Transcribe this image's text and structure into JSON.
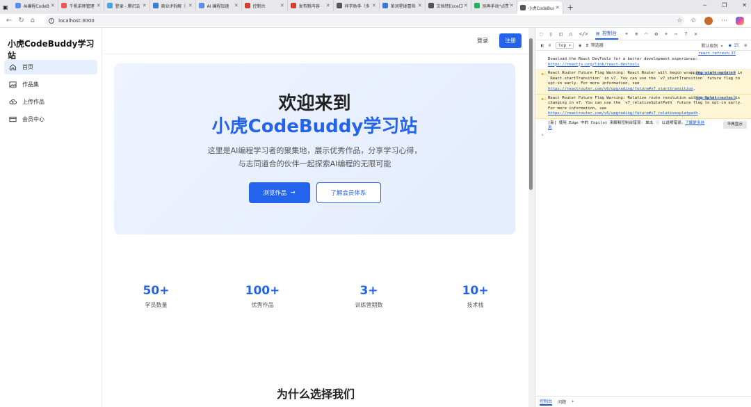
{
  "browser": {
    "tabs": [
      {
        "label": "AI编程CodeBu",
        "color": "#5b8def"
      },
      {
        "label": "千帆讲师管理",
        "color": "#e85a5a"
      },
      {
        "label": "登录 - 腾讯云",
        "color": "#4aa3df"
      },
      {
        "label": "商业IP拆解（",
        "color": "#3a7bd5"
      },
      {
        "label": "AI 编程加速",
        "color": "#5b8def"
      },
      {
        "label": "控制台",
        "color": "#d23f31"
      },
      {
        "label": "发布新内容",
        "color": "#d23f31"
      },
      {
        "label": "伴学助手（多",
        "color": "#555555"
      },
      {
        "label": "单词星球冒险",
        "color": "#3a7bd5"
      },
      {
        "label": "文档转Excel工",
        "color": "#555555"
      },
      {
        "label": "别再手动\"点赞",
        "color": "#21b35b"
      },
      {
        "label": "小虎CodeBud",
        "color": "#555555",
        "active": true
      }
    ],
    "url": "localhost:3000"
  },
  "app": {
    "brand": "小虎CodeBuddy学习站",
    "sidebar": [
      {
        "label": "首页",
        "icon": "home-icon",
        "active": true
      },
      {
        "label": "作品集",
        "icon": "image-icon"
      },
      {
        "label": "上传作品",
        "icon": "cloud-upload-icon"
      },
      {
        "label": "会员中心",
        "icon": "card-icon"
      }
    ],
    "topnav": {
      "login": "登录",
      "register": "注册"
    },
    "hero": {
      "title": "欢迎来到",
      "subtitle": "小虎CodeBuddy学习站",
      "desc1": "这里是AI编程学习者的聚集地，展示优秀作品，分享学习心得，",
      "desc2": "与志同道合的伙伴一起探索AI编程的无限可能",
      "primary": "浏览作品",
      "secondary": "了解会员体系"
    },
    "stats": [
      {
        "num": "50+",
        "label": "学员数量"
      },
      {
        "num": "100+",
        "label": "优秀作品"
      },
      {
        "num": "3+",
        "label": "训练营期数"
      },
      {
        "num": "10+",
        "label": "技术栈"
      }
    ],
    "why": "为什么选择我们"
  },
  "devtools": {
    "tab_console": "控制台",
    "context": "top",
    "filter": "筛选器",
    "level": "默认级别",
    "issues": "15",
    "msg1_src": "react_refresh:37",
    "msg1_text": "Download the React DevTools for a better development experience: ",
    "msg1_link": "https://reactjs.org/link/react-devtools",
    "msg2_src": "deprecations.ts:9",
    "msg2_text": "React Router Future Flag Warning: React Router will begin wrapping state updates in `React.startTransition` in v7. You can use the `v7_startTransition` future flag to opt-in early. For more information, see ",
    "msg2_link": "https://reactrouter.com/v6/upgrading/future#v7_starttransition",
    "msg3_src": "deprecations.ts:9",
    "msg3_text": "React Router Future Flag Warning: Relative route resolution within Splat routes is changing in v7. You can use the `v7_relativeSplatPath` future flag to opt-in early. For more information, see ",
    "msg3_link": "https://reactrouter.com/v6/upgrading/future#v7_relativesplatpath",
    "copilot_text": "[新] 使用 Edge 中的 Copilot 来解释控制台错误: 单击 ",
    "copilot_text2": " 以说明错误。",
    "copilot_link": "了解更多信息",
    "copilot_btn": "不再显示",
    "foot_console": "控制台",
    "foot_issues": "问题"
  }
}
